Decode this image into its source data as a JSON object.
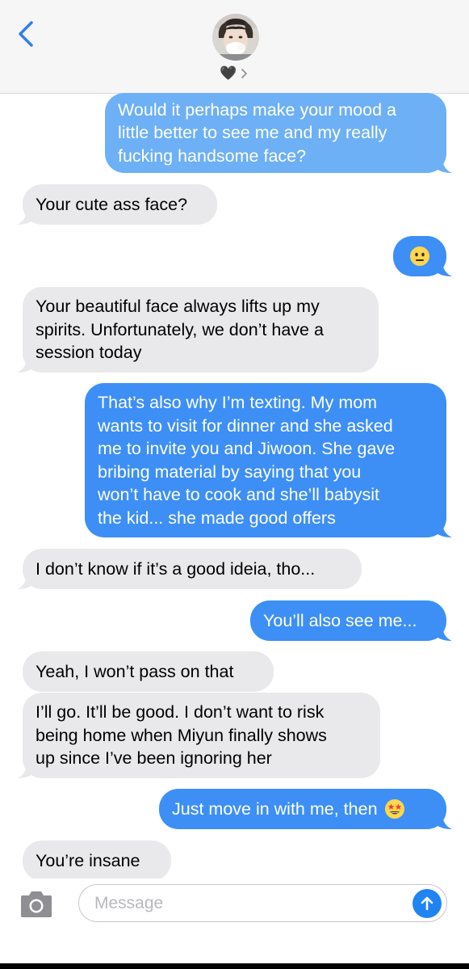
{
  "header": {
    "contact_name": "🖤",
    "back_icon": "chevron-left-icon",
    "details_icon": "chevron-right-icon"
  },
  "messages": [
    {
      "from": "me",
      "text": "Would it perhaps make your mood a\nlittle better to see me and my really\nfucking handsome face?"
    },
    {
      "from": "them",
      "text": "Your cute ass face?"
    },
    {
      "from": "me",
      "text": "😐"
    },
    {
      "from": "them",
      "text": "Your beautiful face always lifts up my\nspirits. Unfortunately, we don’t have a\nsession today"
    },
    {
      "from": "me",
      "text": "That’s also why I’m texting. My mom\nwants to visit for dinner and she asked\nme to invite you and Jiwoon. She gave\nbribing material by saying that you\nwon’t have to cook and she’ll babysit\nthe kid... she made good offers"
    },
    {
      "from": "them",
      "text": "I don’t know if it’s a good ideia, tho..."
    },
    {
      "from": "me",
      "text": "You’ll also see me..."
    },
    {
      "from": "them",
      "text": "Yeah, I won’t pass on that"
    },
    {
      "from": "them",
      "text": "I’ll go. It’ll be good. I don’t want to risk\nbeing home when Miyun finally shows\nup since I’ve been ignoring her"
    },
    {
      "from": "me",
      "text": "Just move in with me, then",
      "emoji": "🤩"
    },
    {
      "from": "them",
      "text": "You’re insane"
    }
  ],
  "composer": {
    "placeholder": "Message",
    "camera_icon": "camera-icon",
    "send_icon": "arrow-up-icon"
  },
  "colors": {
    "outgoing": "#3d8ff6",
    "outgoing_light": "#6db0f5",
    "incoming": "#e9e9eb",
    "accent": "#1f84f2"
  }
}
